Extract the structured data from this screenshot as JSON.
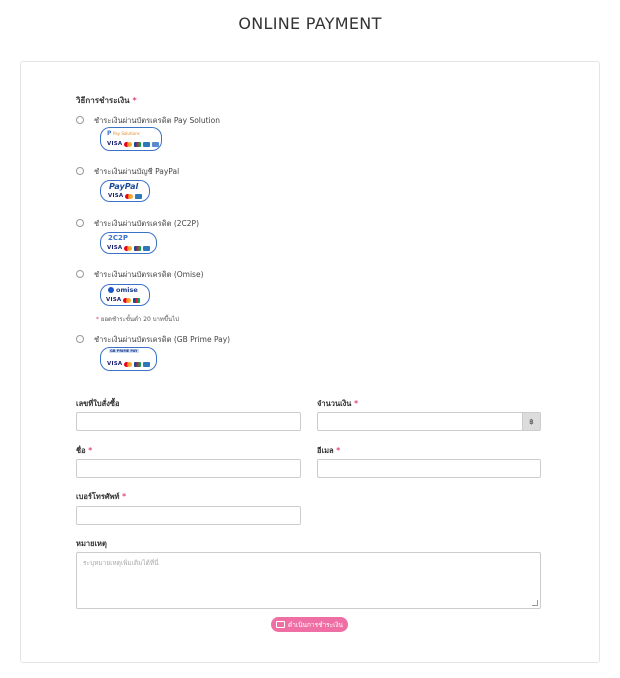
{
  "title": "ONLINE PAYMENT",
  "payment_section": {
    "label": "วิธีการชำระเงิน",
    "required_mark": "*",
    "methods": [
      {
        "label": "ชำระเงินผ่านบัตรเครดิต Pay Solution",
        "logo_text": "Pay Solutions",
        "logo_icon": "pay-solution-logo"
      },
      {
        "label": "ชำระเงินผ่านบัญชี PayPal",
        "logo_text": "PayPal",
        "logo_icon": "paypal-logo"
      },
      {
        "label": "ชำระเงินผ่านบัตรเครดิต (2C2P)",
        "logo_text": "2C2P",
        "logo_icon": "2c2p-logo"
      },
      {
        "label": "ชำระเงินผ่านบัตรเครดิต (Omise)",
        "logo_text": "omise",
        "logo_icon": "omise-logo",
        "note": "ยอดชำระขั้นต่ำ 20 บาทขึ้นไป",
        "note_mark": "*"
      },
      {
        "label": "ชำระเงินผ่านบัตรเครดิต (GB Prime Pay)",
        "logo_text": "GB PRIME PAY",
        "logo_icon": "gbprimepay-logo"
      }
    ],
    "card_brand_visa": "VISA"
  },
  "form": {
    "order_number": {
      "label": "เลขที่ใบสั่งซื้อ",
      "value": ""
    },
    "amount": {
      "label": "จำนวนเงิน",
      "required_mark": "*",
      "value": "",
      "currency": "฿"
    },
    "name": {
      "label": "ชื่อ",
      "required_mark": "*",
      "value": ""
    },
    "email": {
      "label": "อีเมล",
      "required_mark": "*",
      "value": ""
    },
    "phone": {
      "label": "เบอร์โทรศัพท์",
      "required_mark": "*",
      "value": ""
    },
    "note": {
      "label": "หมายเหตุ",
      "placeholder": "ระบุหมายเหตุเพิ่มเติมได้ที่นี่"
    }
  },
  "submit": {
    "icon": "payment-icon",
    "label": "ดำเนินการชำระเงิน"
  },
  "colors": {
    "accent": "#ef6fa5",
    "required": "#e0457b",
    "logo_border": "#3a72c8"
  }
}
